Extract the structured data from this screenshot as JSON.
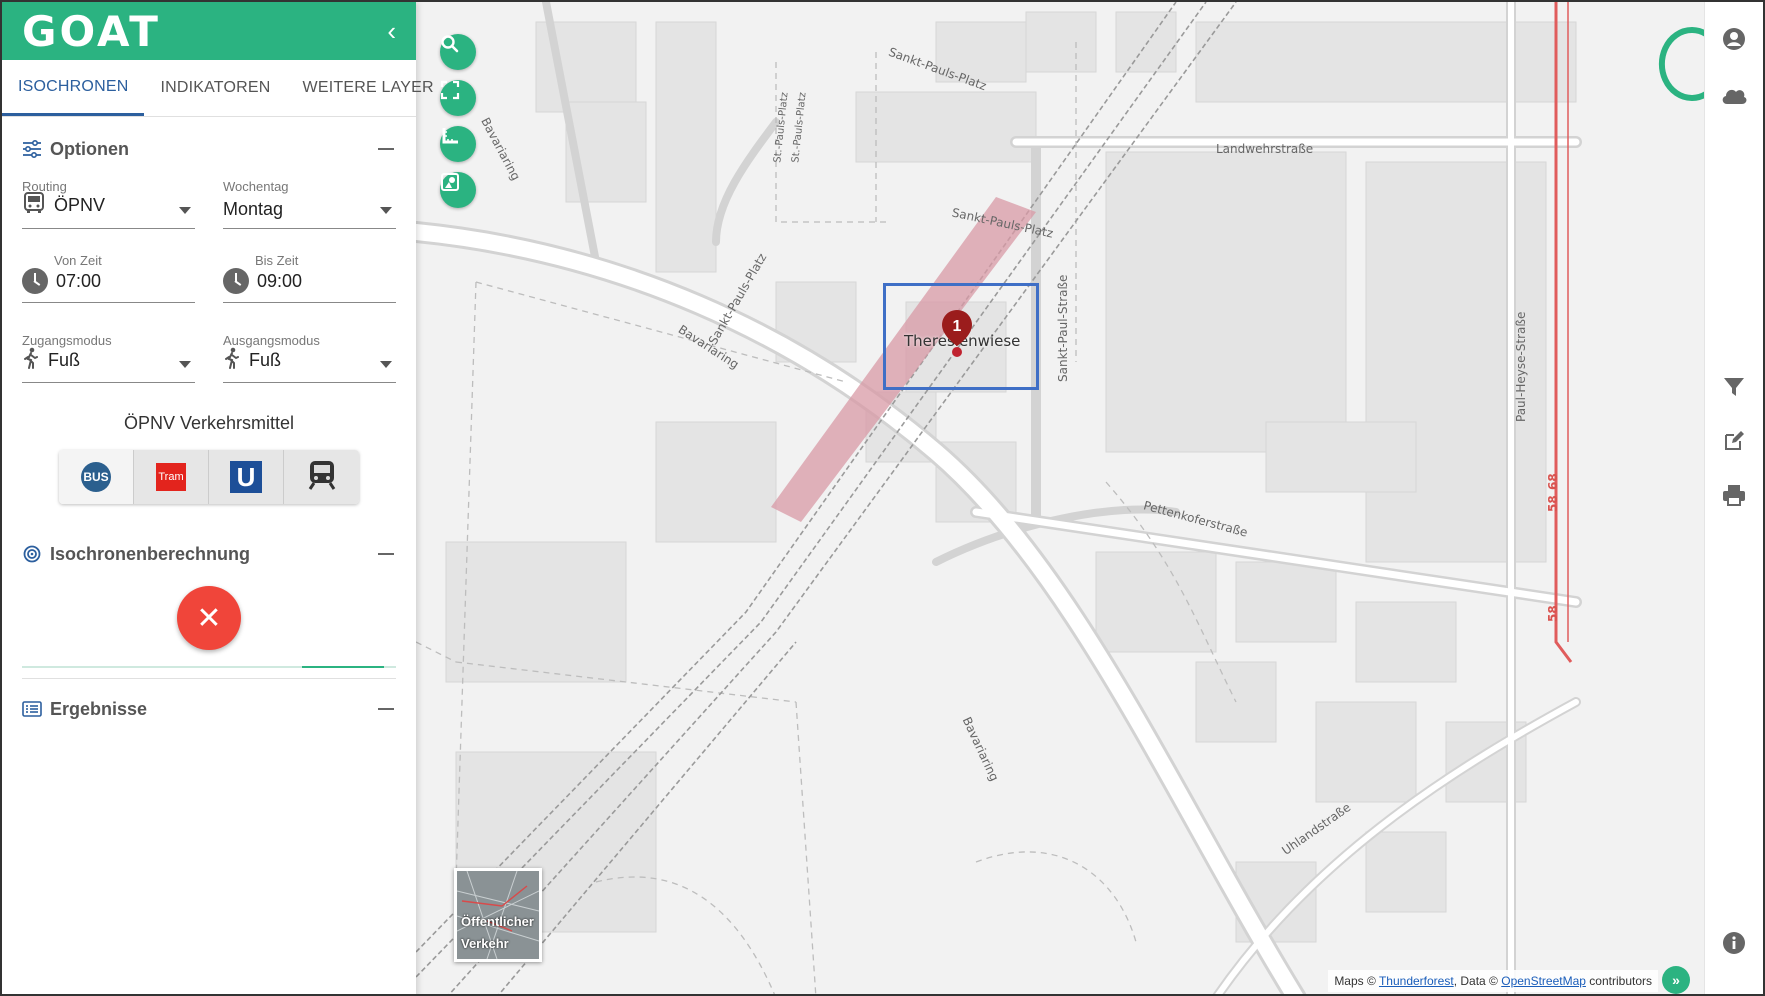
{
  "app": {
    "logo": "GOAT"
  },
  "tabs": [
    {
      "label": "ISOCHRONEN",
      "active": true
    },
    {
      "label": "INDIKATOREN",
      "active": false
    },
    {
      "label": "WEITERE LAYER",
      "active": false
    }
  ],
  "options": {
    "title": "Optionen",
    "routing": {
      "label": "Routing",
      "value": "ÖPNV",
      "icon": "bus-icon"
    },
    "weekday": {
      "label": "Wochentag",
      "value": "Montag"
    },
    "from_time": {
      "label": "Von Zeit",
      "value": "07:00"
    },
    "to_time": {
      "label": "Bis Zeit",
      "value": "09:00"
    },
    "access_mode": {
      "label": "Zugangsmodus",
      "value": "Fuß",
      "icon": "walk-icon"
    },
    "egress_mode": {
      "label": "Ausgangsmodus",
      "value": "Fuß",
      "icon": "walk-icon"
    },
    "transit_title": "ÖPNV Verkehrsmittel",
    "transit_modes": [
      {
        "name": "bus",
        "label": "BUS"
      },
      {
        "name": "tram",
        "label": "Tram"
      },
      {
        "name": "ubahn",
        "label": "U"
      },
      {
        "name": "train",
        "label": ""
      }
    ]
  },
  "isochrone": {
    "title": "Isochronenberechnung",
    "action_symbol": "✕"
  },
  "results": {
    "title": "Ergebnisse"
  },
  "map": {
    "station_label": "Theresienwiese",
    "marker_number": "1",
    "streets": [
      "Sankt-Pauls-Platz",
      "Landwehrstraße",
      "St.-Pauls-Platz",
      "St.-Pauls-Platz",
      "Bavariaring",
      "Sankt-Pauls-Platz",
      "Sankt-Pauls-Platz",
      "Bavariaring",
      "Sankt-Paul-Straße",
      "Pettenkoferstraße",
      "Bavariaring",
      "Paul-Heyse-Straße",
      "Uhlandstraße",
      "58",
      "68",
      "58"
    ],
    "layer_thumbnail_label": "Öffentlicher Verkehr",
    "attribution": {
      "prefix": "Maps ©",
      "link1": "Thunderforest",
      "middle": ", Data ©",
      "link2": "OpenStreetMap",
      "suffix": "contributors"
    },
    "attr_toggle": "»"
  },
  "colors": {
    "brand": "#2bb381",
    "tab_active": "#2c5f9e",
    "danger": "#f0453a",
    "station_area": "#d89aa5",
    "marker": "#9b1c1c",
    "highlight": "#3f6fc6"
  }
}
